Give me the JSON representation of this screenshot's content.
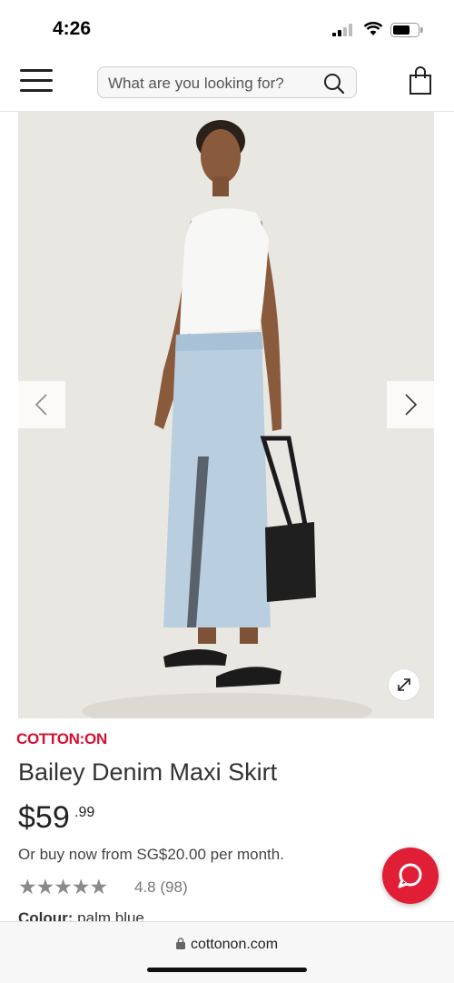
{
  "status_bar": {
    "time": "4:26"
  },
  "header": {
    "search_placeholder": "What are you looking for?"
  },
  "product": {
    "brand": "COTTON:ON",
    "name": "Bailey Denim Maxi Skirt",
    "price_main": "$59",
    "price_cents": ".99",
    "installment": "Or buy now from SG$20.00 per month.",
    "stars": "★★★★★",
    "rating": "4.8",
    "review_count": "(98)",
    "rating_value": 4.8,
    "colour_label": "Colour:",
    "colour_value": "palm blue"
  },
  "browser": {
    "url": "cottonon.com"
  },
  "colors": {
    "brand_red": "#d6102e",
    "chat_red": "#e01e35"
  }
}
